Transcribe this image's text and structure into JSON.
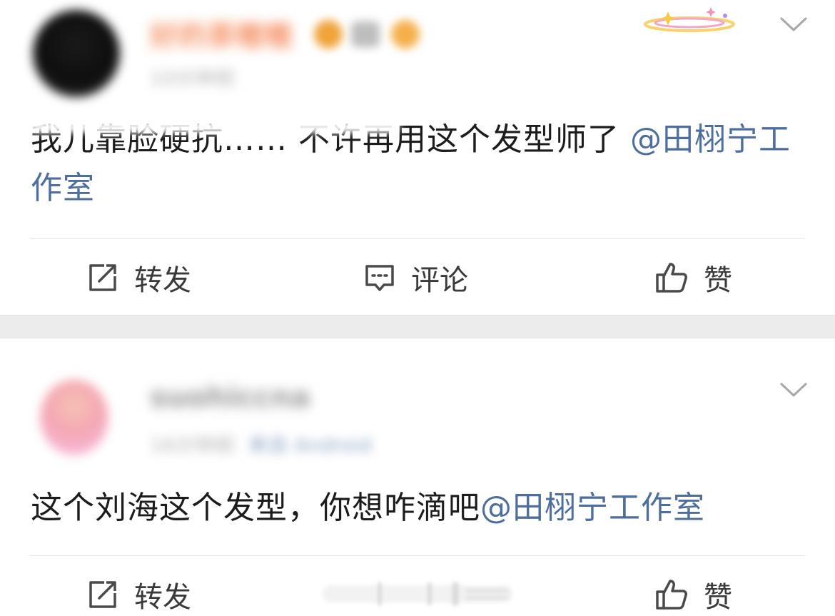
{
  "posts": [
    {
      "username": "好的茶嗷嗷",
      "meta": "10分钟前",
      "text": "我儿靠脸硬抗…… 不许再用这个发型师了",
      "mention": "@田栩宁工作室",
      "actions": {
        "repost": "转发",
        "comment": "评论",
        "like": "赞"
      }
    },
    {
      "username": "suohiccna",
      "meta": "16分钟前",
      "source": "来自 Android",
      "text": "这个刘海这个发型，你想咋滴吧",
      "mention": "@田栩宁工作室",
      "actions": {
        "repost": "转发",
        "like": "赞"
      }
    }
  ],
  "colors": {
    "mention": "#4e6e9e",
    "text": "#1c1c1c",
    "action_text": "#3a3a3a",
    "divider": "#e4e4e4",
    "separator_band": "#ececec"
  },
  "icons": {
    "repost": "repost-icon",
    "comment": "comment-icon",
    "like": "thumbs-up-icon",
    "menu": "chevron-down-icon"
  }
}
